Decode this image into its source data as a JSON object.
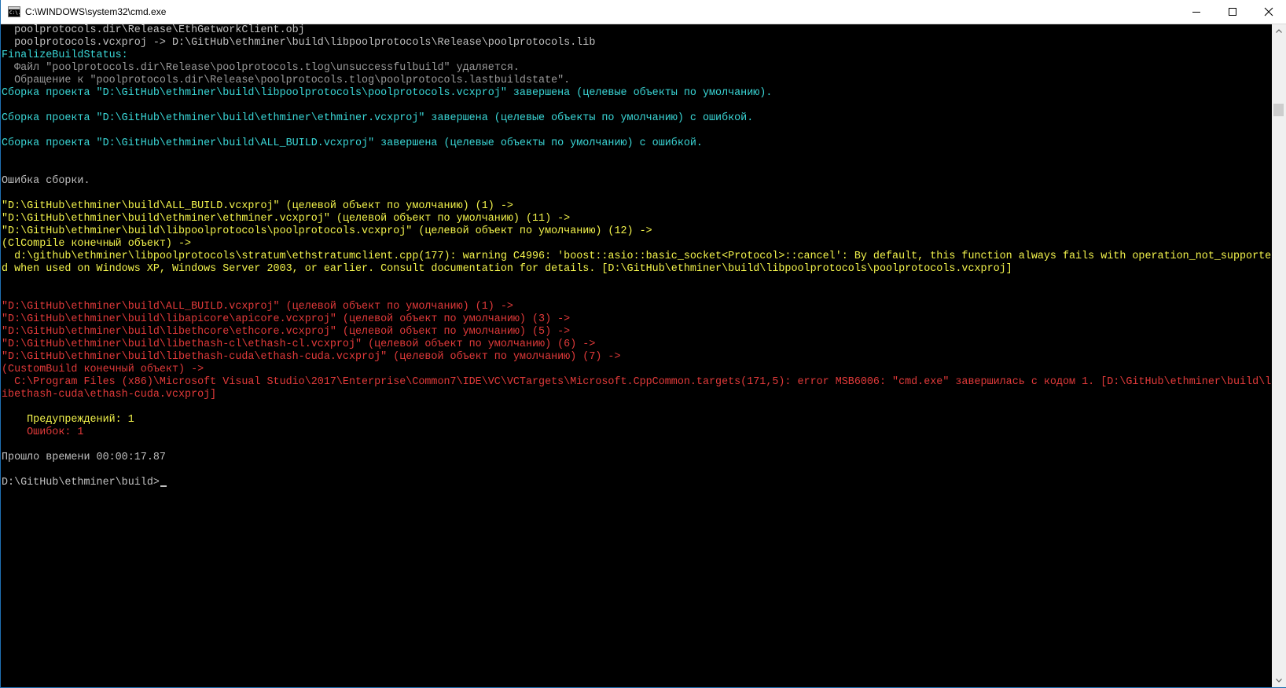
{
  "window": {
    "title": "C:\\WINDOWS\\system32\\cmd.exe",
    "icon_text": "C:\\."
  },
  "console": {
    "lines": [
      {
        "text": "  poolprotocols.dir\\Release\\EthGetworkClient.obj",
        "color": "gray"
      },
      {
        "text": "  poolprotocols.vcxproj -> D:\\GitHub\\ethminer\\build\\libpoolprotocols\\Release\\poolprotocols.lib",
        "color": "gray"
      },
      {
        "text": "FinalizeBuildStatus:",
        "color": "cyan"
      },
      {
        "text": "  Файл \"poolprotocols.dir\\Release\\poolprotocols.tlog\\unsuccessfulbuild\" удаляется.",
        "color": "dim"
      },
      {
        "text": "  Обращение к \"poolprotocols.dir\\Release\\poolprotocols.tlog\\poolprotocols.lastbuildstate\".",
        "color": "dim"
      },
      {
        "text": "Сборка проекта \"D:\\GitHub\\ethminer\\build\\libpoolprotocols\\poolprotocols.vcxproj\" завершена (целевые объекты по умолчанию).",
        "color": "cyan"
      },
      {
        "text": "",
        "color": "gray"
      },
      {
        "text": "Сборка проекта \"D:\\GitHub\\ethminer\\build\\ethminer\\ethminer.vcxproj\" завершена (целевые объекты по умолчанию) с ошибкой.",
        "color": "cyan"
      },
      {
        "text": "",
        "color": "gray"
      },
      {
        "text": "Сборка проекта \"D:\\GitHub\\ethminer\\build\\ALL_BUILD.vcxproj\" завершена (целевые объекты по умолчанию) с ошибкой.",
        "color": "cyan"
      },
      {
        "text": "",
        "color": "gray"
      },
      {
        "text": "",
        "color": "gray"
      },
      {
        "text": "Ошибка сборки.",
        "color": "gray"
      },
      {
        "text": "",
        "color": "gray"
      },
      {
        "text": "\"D:\\GitHub\\ethminer\\build\\ALL_BUILD.vcxproj\" (целевой объект по умолчанию) (1) ->",
        "color": "yellow"
      },
      {
        "text": "\"D:\\GitHub\\ethminer\\build\\ethminer\\ethminer.vcxproj\" (целевой объект по умолчанию) (11) ->",
        "color": "yellow"
      },
      {
        "text": "\"D:\\GitHub\\ethminer\\build\\libpoolprotocols\\poolprotocols.vcxproj\" (целевой объект по умолчанию) (12) ->",
        "color": "yellow"
      },
      {
        "text": "(ClCompile конечный объект) ->",
        "color": "yellow"
      },
      {
        "text": "  d:\\github\\ethminer\\libpoolprotocols\\stratum\\ethstratumclient.cpp(177): warning C4996: 'boost::asio::basic_socket<Protocol>::cancel': By default, this function always fails with operation_not_supporte",
        "color": "yellow"
      },
      {
        "text": "d when used on Windows XP, Windows Server 2003, or earlier. Consult documentation for details. [D:\\GitHub\\ethminer\\build\\libpoolprotocols\\poolprotocols.vcxproj]",
        "color": "yellow"
      },
      {
        "text": "",
        "color": "gray"
      },
      {
        "text": "",
        "color": "gray"
      },
      {
        "text": "\"D:\\GitHub\\ethminer\\build\\ALL_BUILD.vcxproj\" (целевой объект по умолчанию) (1) ->",
        "color": "red"
      },
      {
        "text": "\"D:\\GitHub\\ethminer\\build\\libapicore\\apicore.vcxproj\" (целевой объект по умолчанию) (3) ->",
        "color": "red"
      },
      {
        "text": "\"D:\\GitHub\\ethminer\\build\\libethcore\\ethcore.vcxproj\" (целевой объект по умолчанию) (5) ->",
        "color": "red"
      },
      {
        "text": "\"D:\\GitHub\\ethminer\\build\\libethash-cl\\ethash-cl.vcxproj\" (целевой объект по умолчанию) (6) ->",
        "color": "red"
      },
      {
        "text": "\"D:\\GitHub\\ethminer\\build\\libethash-cuda\\ethash-cuda.vcxproj\" (целевой объект по умолчанию) (7) ->",
        "color": "red"
      },
      {
        "text": "(CustomBuild конечный объект) ->",
        "color": "red"
      },
      {
        "text": "  C:\\Program Files (x86)\\Microsoft Visual Studio\\2017\\Enterprise\\Common7\\IDE\\VC\\VCTargets\\Microsoft.CppCommon.targets(171,5): error MSB6006: \"cmd.exe\" завершилась с кодом 1. [D:\\GitHub\\ethminer\\build\\l",
        "color": "red"
      },
      {
        "text": "ibethash-cuda\\ethash-cuda.vcxproj]",
        "color": "red"
      },
      {
        "text": "",
        "color": "gray"
      },
      {
        "text": "    Предупреждений: 1",
        "color": "yellow"
      },
      {
        "text": "    Ошибок: 1",
        "color": "red"
      },
      {
        "text": "",
        "color": "gray"
      },
      {
        "text": "Прошло времени 00:00:17.87",
        "color": "gray"
      },
      {
        "text": "",
        "color": "gray"
      },
      {
        "text": "D:\\GitHub\\ethminer\\build>",
        "color": "gray",
        "prompt": true
      }
    ]
  },
  "colors": {
    "gray": "#c0c0c0",
    "dim": "#9a9a9a",
    "cyan": "#3ad7d7",
    "yellow": "#f4f44c",
    "red": "#e23a3a"
  },
  "icons": {
    "minimize": "minimize-icon",
    "maximize": "maximize-icon",
    "close": "close-icon",
    "scroll_up": "chevron-up-icon",
    "scroll_down": "chevron-down-icon"
  }
}
